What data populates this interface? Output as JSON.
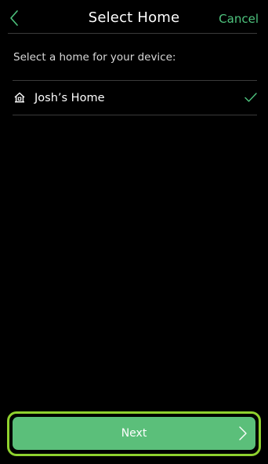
{
  "header": {
    "title": "Select Home",
    "cancel_label": "Cancel",
    "back_icon": "chevron-left-icon"
  },
  "prompt": "Select a home for your device:",
  "homes": [
    {
      "label": "Josh’s Home",
      "icon": "home-icon",
      "selected": true
    }
  ],
  "footer": {
    "next_label": "Next",
    "next_icon": "chevron-right-icon"
  },
  "colors": {
    "background": "#000000",
    "accent": "#4ec47e",
    "button": "#5bbf7a",
    "highlight": "#8fd12e",
    "divider": "#3a3a3a"
  }
}
